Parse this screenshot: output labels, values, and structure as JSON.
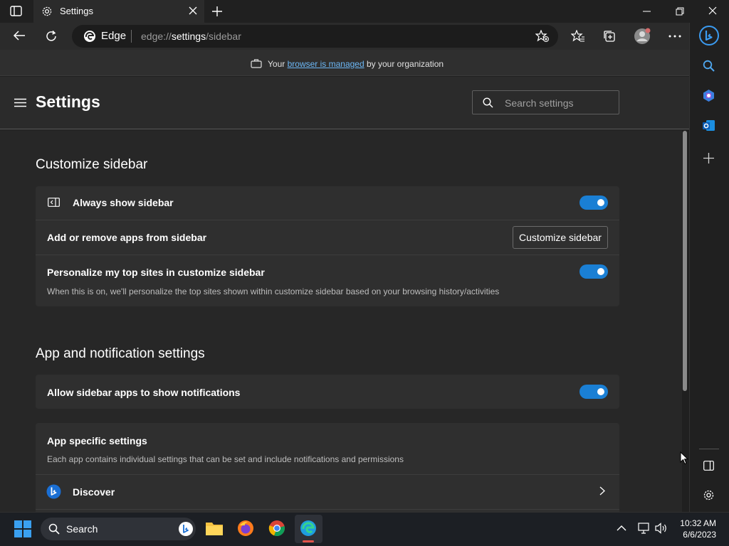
{
  "window": {
    "tab_title": "Settings",
    "tab_icon": "gear-icon"
  },
  "address": {
    "site_label": "Edge",
    "url_prefix": "edge://",
    "url_host": "settings",
    "url_path": "/sidebar"
  },
  "banner": {
    "prefix": "Your ",
    "link": "browser is managed",
    "suffix": " by your organization"
  },
  "header": {
    "title": "Settings",
    "search_placeholder": "Search settings"
  },
  "customize": {
    "title": "Customize sidebar",
    "always_show": "Always show sidebar",
    "add_remove": "Add or remove apps from sidebar",
    "customize_button": "Customize sidebar",
    "personalize": "Personalize my top sites in customize sidebar",
    "personalize_desc": "When this is on, we'll personalize the top sites shown within customize sidebar based on your browsing history/activities"
  },
  "apps": {
    "title": "App and notification settings",
    "allow_notifications": "Allow sidebar apps to show notifications",
    "specific_title": "App specific settings",
    "specific_desc": "Each app contains individual settings that can be set and include notifications and permissions",
    "discover": "Discover"
  },
  "taskbar": {
    "search_label": "Search",
    "time": "10:32 AM",
    "date": "6/6/2023"
  },
  "colors": {
    "accent": "#1a7fd4",
    "link": "#6cb7f5",
    "background": "#272727"
  },
  "toggles": {
    "always_show_sidebar": true,
    "personalize_top_sites": true,
    "allow_notifications": true
  }
}
